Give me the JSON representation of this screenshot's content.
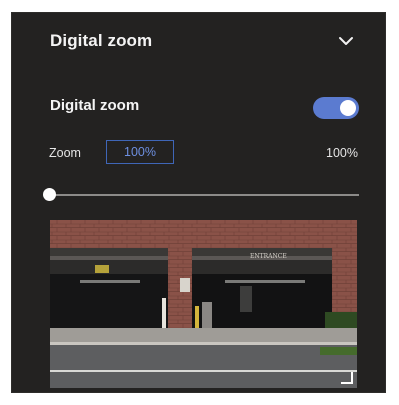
{
  "header": {
    "title": "Digital zoom",
    "collapse_icon": "chevron-down-icon"
  },
  "toggle": {
    "label": "Digital zoom",
    "enabled": true
  },
  "zoom": {
    "label": "Zoom",
    "input_value": "100%",
    "readout": "100%",
    "slider_level": 0
  },
  "preview": {
    "sign_text": "ENTRANCE",
    "resize_icon": "resize-corner-icon"
  },
  "colors": {
    "panel_bg": "#232221",
    "accent": "#5b7bd0",
    "input_border": "#3f66b7"
  }
}
